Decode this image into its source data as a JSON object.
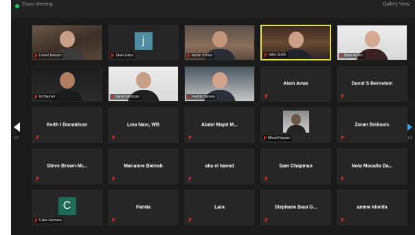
{
  "window": {
    "title": "Zoom Meeting",
    "view_label": "Gallery View"
  },
  "pagination": {
    "prev_label": "1/2",
    "next_label": "1/2"
  },
  "colors": {
    "active_speaker": "#e7e73c",
    "muted_mic": "#d42d2d",
    "next_arrow": "#3aa0e5"
  },
  "tiles": [
    {
      "kind": "video",
      "scene": "s-brown",
      "label": "Daniel Balsam",
      "skin": "#c9a08a",
      "shirt": "#3a3a3a"
    },
    {
      "kind": "letter",
      "letter": "j",
      "bg": "#4f8da3",
      "label": "Janet Gaba"
    },
    {
      "kind": "video",
      "scene": "s-room",
      "label": "Martin Schulz",
      "skin": "#c3957c",
      "shirt": "#2a2d36"
    },
    {
      "kind": "video",
      "scene": "s-office",
      "label": "Giles Smith",
      "skin": "#caa08a",
      "shirt": "#1f2330",
      "active": true
    },
    {
      "kind": "video",
      "scene": "s-light",
      "label": "Bella Ashton",
      "skin": "#d5a890",
      "shirt": "#3a2222"
    },
    {
      "kind": "video",
      "scene": "s-dark",
      "label": "Efi Barnett",
      "skin": "#b07d63",
      "shirt": "#1a1a1a"
    },
    {
      "kind": "video",
      "scene": "s-light",
      "label": "Sarah Alzahrani",
      "skin": "#c8a088",
      "shirt": "#202020"
    },
    {
      "kind": "video",
      "scene": "s-blue",
      "label": "Fredrik Hansen",
      "skin": "#d2a48d",
      "shirt": "#2b2f3a"
    },
    {
      "kind": "name",
      "label": "Alain Amar"
    },
    {
      "kind": "name",
      "label": "David S Bernstein"
    },
    {
      "kind": "name",
      "label": "Keith I Donaldson"
    },
    {
      "kind": "name",
      "label": "Lina Nasr, WB"
    },
    {
      "kind": "name",
      "label": "Abdel Majid M..."
    },
    {
      "kind": "photo",
      "label": "Manal Hazzan"
    },
    {
      "kind": "name",
      "label": "Zoran Biskovic"
    },
    {
      "kind": "name",
      "label": "Steve Brown-Mi..."
    },
    {
      "kind": "name",
      "label": "Marianne Bahrah"
    },
    {
      "kind": "name",
      "label": "alia el hamid"
    },
    {
      "kind": "name",
      "label": "Sam Chapman"
    },
    {
      "kind": "name",
      "label": "Nola Moualla Da..."
    },
    {
      "kind": "letter",
      "letter": "C",
      "bg": "#1e6b57",
      "label": "Clare Ferrreira"
    },
    {
      "kind": "name",
      "label": "Farida"
    },
    {
      "kind": "name",
      "label": "Lara"
    },
    {
      "kind": "name",
      "label": "Stephane Baui G..."
    },
    {
      "kind": "name",
      "label": "amine khelifa"
    }
  ]
}
